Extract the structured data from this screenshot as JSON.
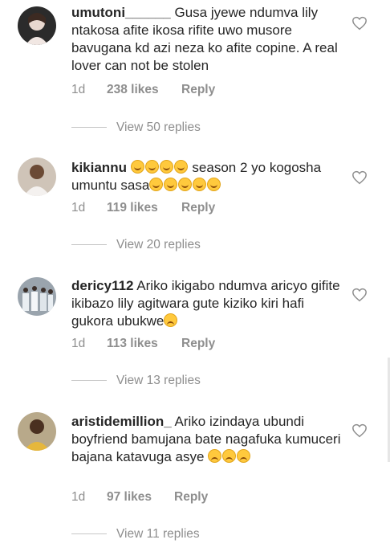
{
  "comments": [
    {
      "username": "umutoni______",
      "text": " Gusa jyewe ndumva lily ntakosa afite ikosa rifite uwo musore bavugana kd azi neza ko afite copine. A real lover can not be stolen",
      "time": "1d",
      "likes": "238 likes",
      "reply": "Reply",
      "view_replies": "View 50 replies",
      "emoji_suffix": []
    },
    {
      "username": "kikiannu",
      "text": " season 2 yo kogosha umuntu sasa",
      "time": "1d",
      "likes": "119 likes",
      "reply": "Reply",
      "view_replies": "View 20 replies",
      "emoji_prefix": [
        "rofl",
        "rofl",
        "rofl",
        "rofl"
      ],
      "emoji_suffix": [
        "rofl",
        "rofl",
        "rofl",
        "rofl",
        "rofl"
      ]
    },
    {
      "username": "dericy112",
      "text": " Ariko ikigabo ndumva aricyo gifite ikibazo lily agitwara gute kiziko kiri hafi gukora ubukwe",
      "time": "1d",
      "likes": "113 likes",
      "reply": "Reply",
      "view_replies": "View 13 replies",
      "emoji_suffix": [
        "sad-face"
      ]
    },
    {
      "username": "aristidemillion_",
      "text": " Ariko izindaya ubundi boyfriend bamujana bate nagafuka kumuceri bajana katavuga asye ",
      "time": "1d",
      "likes": "97 likes",
      "reply": "Reply",
      "view_replies": "View 11 replies",
      "emoji_suffix": [
        "sad-face",
        "sad-face",
        "sad-face"
      ]
    }
  ],
  "colors": {
    "text": "#262626",
    "secondary": "#8e8e8e",
    "divider": "#c7c7c7"
  }
}
